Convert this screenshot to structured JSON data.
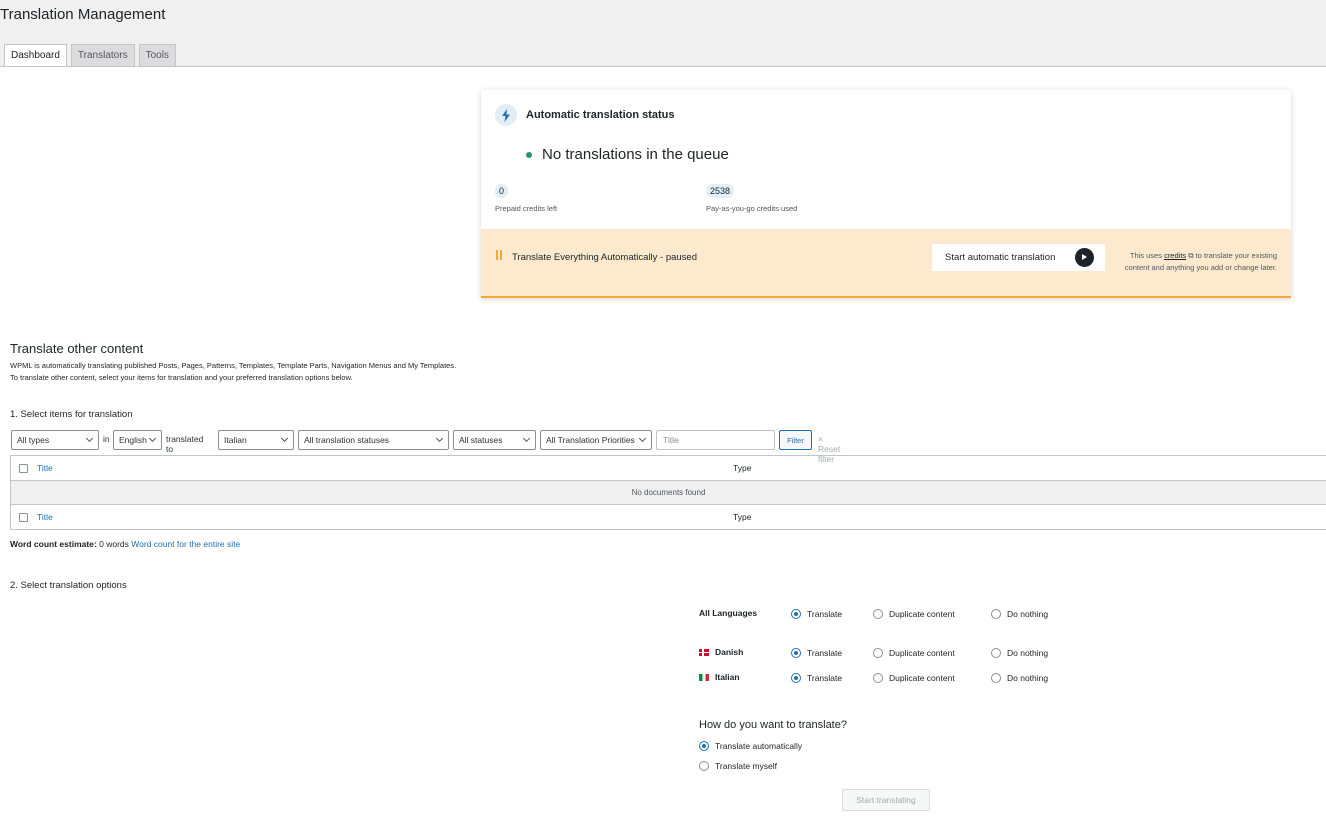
{
  "page": {
    "title": "Translation Management"
  },
  "tabs": [
    {
      "label": "Dashboard",
      "active": true
    },
    {
      "label": "Translators",
      "active": false
    },
    {
      "label": "Tools",
      "active": false
    }
  ],
  "auto_status": {
    "title": "Automatic translation status",
    "icon": "lightning-icon",
    "queue_text": "No translations in the queue",
    "prepaid": {
      "value": "0",
      "label": "Prepaid credits left"
    },
    "payg": {
      "value": "2538",
      "label": "Pay-as-you-go credits used"
    },
    "footer": {
      "status_text": "Translate Everything Automatically - paused",
      "start_button": "Start automatic translation",
      "note_prefix": "This uses ",
      "note_link": "credits",
      "note_suffix": " to translate your existing content and anything you add or change later."
    },
    "colors": {
      "footer_bg": "#fde9cd",
      "accent": "#f0a93a",
      "dot": "#1d9a73"
    }
  },
  "other_content": {
    "title": "Translate other content",
    "desc_line1": "WPML is automatically translating published Posts, Pages, Patterns, Templates, Template Parts, Navigation Menus and My Templates.",
    "desc_line2": "To translate other content, select your items for translation and your preferred translation options below.",
    "step1": "1. Select items for translation",
    "filters": {
      "type": "All types",
      "in": "in",
      "source": "English",
      "translated_to": "translated to",
      "target": "Italian",
      "translation_status": "All translation statuses",
      "status": "All statuses",
      "priority": "All Translation Priorities",
      "title_placeholder": "Title",
      "filter_button": "Filter",
      "reset": "Reset filter"
    },
    "table": {
      "col_title": "Title",
      "col_type": "Type",
      "empty": "No documents found"
    },
    "word_count": {
      "label": "Word count estimate:",
      "value": "0 words",
      "link": "Word count for the entire site"
    },
    "step2": "2. Select translation options",
    "languages": [
      {
        "name": "All Languages",
        "flag": "",
        "choice": "Translate"
      },
      {
        "name": "Danish",
        "flag": "dk",
        "choice": "Translate"
      },
      {
        "name": "Italian",
        "flag": "it",
        "choice": "Translate"
      }
    ],
    "option_labels": {
      "translate": "Translate",
      "duplicate": "Duplicate content",
      "nothing": "Do nothing"
    },
    "how": {
      "question": "How do you want to translate?",
      "auto": "Translate automatically",
      "myself": "Translate myself",
      "selected": "auto"
    },
    "start_button": "Start translating"
  }
}
